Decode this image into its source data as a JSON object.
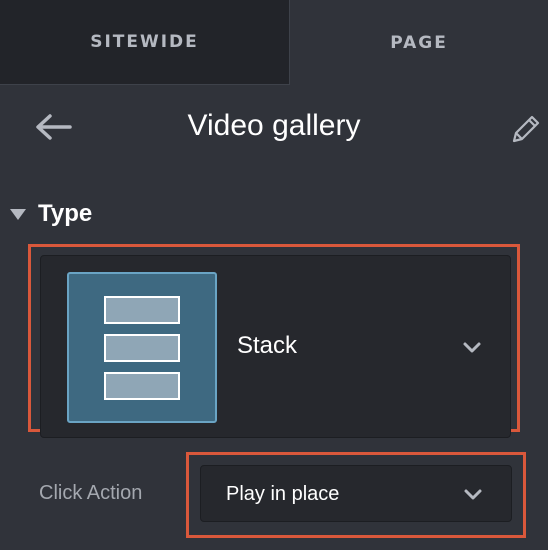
{
  "tabs": {
    "sitewide_label": "SITEWIDE",
    "page_label": "PAGE"
  },
  "header": {
    "title": "Video gallery",
    "back_icon": "arrow-left-icon",
    "edit_icon": "pencil-icon"
  },
  "type_section": {
    "label": "Type",
    "selected_value": "Stack",
    "thumbnail_icon": "stack-layout-icon"
  },
  "click_action": {
    "label": "Click Action",
    "selected_value": "Play in place"
  },
  "colors": {
    "highlight": "#d9583b",
    "thumb_bg": "#3e6981"
  }
}
